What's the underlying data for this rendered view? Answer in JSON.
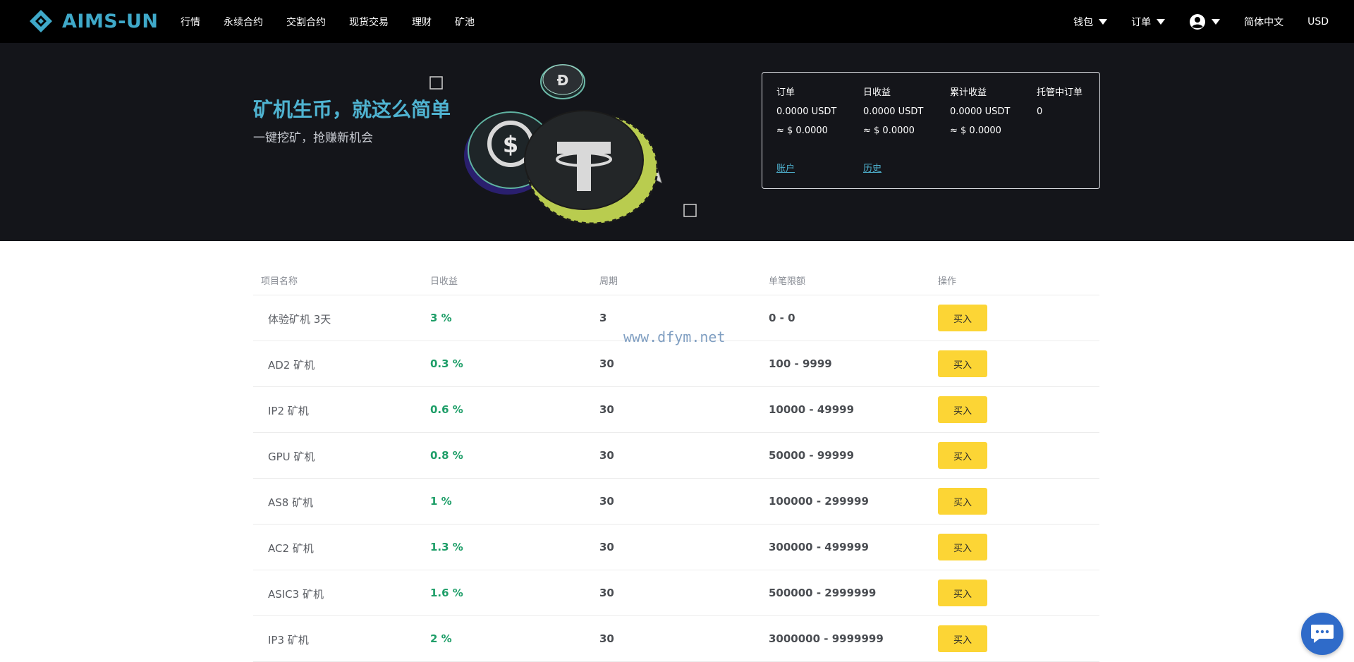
{
  "brand": {
    "name": "AIMS-UN",
    "color": "#3fa9c9"
  },
  "nav": {
    "left": [
      "行情",
      "永续合约",
      "交割合约",
      "现货交易",
      "理财",
      "矿池"
    ],
    "wallet": "钱包",
    "orders": "订单",
    "user_icon": "user-circle-icon",
    "language": "简体中文",
    "currency": "USD"
  },
  "hero": {
    "title": "矿机生币，就这么简单",
    "subtitle": "一键挖矿，抢赚新机会"
  },
  "stats": {
    "columns": [
      {
        "label": "订单",
        "value": "0.0000 USDT",
        "usd": "≈ $ 0.0000"
      },
      {
        "label": "日收益",
        "value": "0.0000 USDT",
        "usd": "≈ $ 0.0000"
      },
      {
        "label": "累计收益",
        "value": "0.0000 USDT",
        "usd": "≈ $ 0.0000"
      },
      {
        "label": "托管中订单",
        "value": "0",
        "usd": ""
      }
    ],
    "account_link": "账户",
    "history_link": "历史"
  },
  "table": {
    "headers": [
      "项目名称",
      "日收益",
      "周期",
      "单笔限额",
      "操作"
    ],
    "buy_label": "买入",
    "rows": [
      {
        "name": "体验矿机 3天",
        "rate": "3 %",
        "period": "3",
        "limit": "0 - 0"
      },
      {
        "name": "AD2 矿机",
        "rate": "0.3 %",
        "period": "30",
        "limit": "100 - 9999"
      },
      {
        "name": "IP2 矿机",
        "rate": "0.6 %",
        "period": "30",
        "limit": "10000 - 49999"
      },
      {
        "name": "GPU 矿机",
        "rate": "0.8 %",
        "period": "30",
        "limit": "50000 - 99999"
      },
      {
        "name": "AS8 矿机",
        "rate": "1 %",
        "period": "30",
        "limit": "100000 - 299999"
      },
      {
        "name": "AC2 矿机",
        "rate": "1.3 %",
        "period": "30",
        "limit": "300000 - 499999"
      },
      {
        "name": "ASIC3 矿机",
        "rate": "1.6 %",
        "period": "30",
        "limit": "500000 - 2999999"
      },
      {
        "name": "IP3 矿机",
        "rate": "2 %",
        "period": "30",
        "limit": "3000000 - 9999999"
      }
    ]
  },
  "watermark": "www.dfym.net",
  "colors": {
    "nav_bg": "#000000",
    "hero_bg": "#14151a",
    "accent": "#4fb3d1",
    "positive": "#1e9e68",
    "buy_button": "#fcd535",
    "chat_button": "#2f6bc9"
  }
}
